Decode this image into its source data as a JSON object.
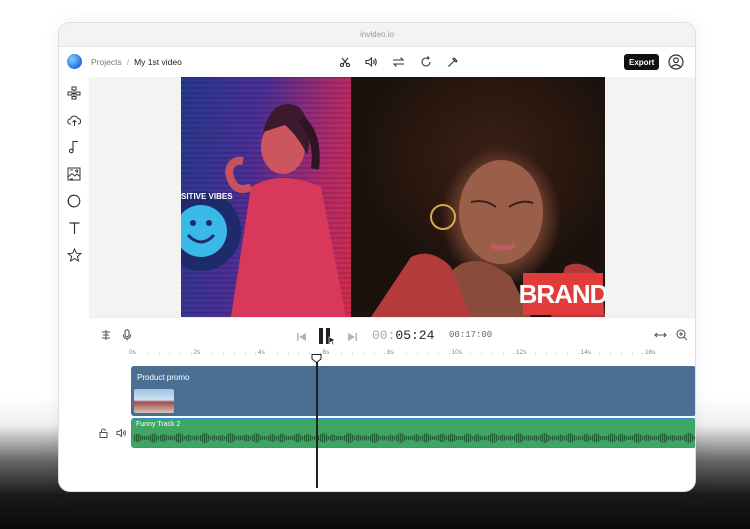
{
  "browser": {
    "url": "invideo.io"
  },
  "topbar": {
    "breadcrumb_projects": "Projects",
    "breadcrumb_separator": "/",
    "breadcrumb_video": "My 1st video",
    "export_label": "Export"
  },
  "preview": {
    "brand_text": "BRAND",
    "sticker_text": "POSITIVE VIBES"
  },
  "timeline": {
    "current_time_prefix": "00:",
    "current_time_main": "05:24",
    "total_time": "00:17:00",
    "ruler_labels": [
      "0s",
      "2s",
      "4s",
      "6s",
      "8s",
      "10s",
      "12s",
      "14s",
      "16s"
    ],
    "video_track_label": "Product promo",
    "audio_track_label": "Funny Track 2"
  },
  "colors": {
    "accent": "#111111",
    "video_track": "#4a6f93",
    "audio_track": "#3fa563",
    "audio_selected_border": "#2b8fd9",
    "brand_tag": "#e23b3b"
  },
  "icons": {
    "sidebar": [
      "layout-icon",
      "upload-icon",
      "music-icon",
      "image-icon",
      "sticker-icon",
      "text-icon",
      "star-icon"
    ],
    "toolbar": [
      "scissors-icon",
      "volume-icon",
      "swap-icon",
      "rotate-icon",
      "magic-wand-icon"
    ]
  }
}
